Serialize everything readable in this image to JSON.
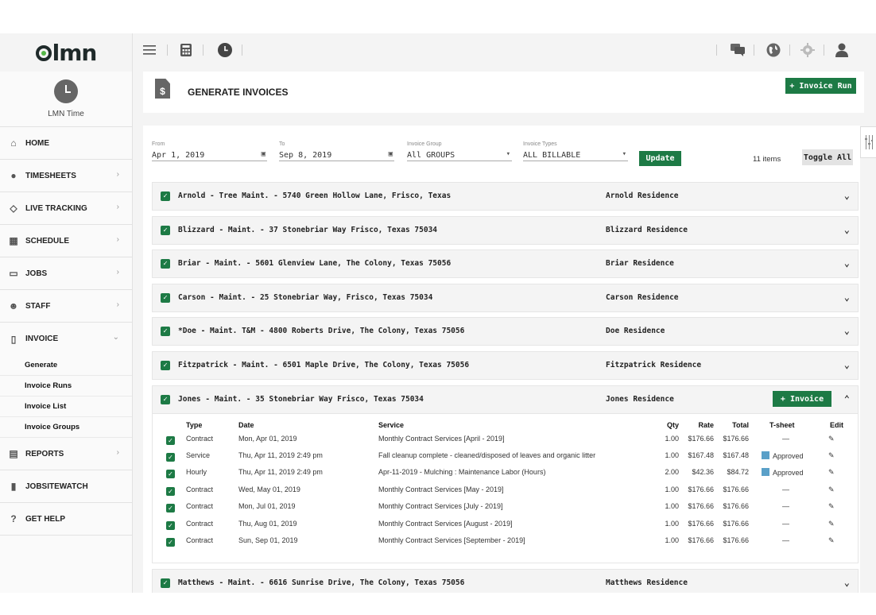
{
  "brand": {
    "logo_text": "lmn"
  },
  "sidebar": {
    "module_label": "LMN Time",
    "items": [
      {
        "label": "HOME",
        "icon": "home-icon",
        "chevron": ""
      },
      {
        "label": "TIMESHEETS",
        "icon": "timesheets-icon",
        "chevron": "›"
      },
      {
        "label": "LIVE TRACKING",
        "icon": "live-tracking-icon",
        "chevron": "›"
      },
      {
        "label": "SCHEDULE",
        "icon": "calendar-icon",
        "chevron": "›"
      },
      {
        "label": "JOBS",
        "icon": "briefcase-icon",
        "chevron": "›"
      },
      {
        "label": "STAFF",
        "icon": "staff-icon",
        "chevron": "›"
      },
      {
        "label": "INVOICE",
        "icon": "invoice-icon",
        "chevron": "⌄"
      }
    ],
    "invoice_sub": [
      "Generate",
      "Invoice Runs",
      "Invoice List",
      "Invoice Groups"
    ],
    "items_after": [
      {
        "label": "REPORTS",
        "icon": "reports-icon",
        "chevron": "›"
      },
      {
        "label": "JOBSITEWATCH",
        "icon": "jobsitewatch-icon",
        "chevron": ""
      },
      {
        "label": "GET HELP",
        "icon": "help-icon",
        "chevron": ""
      }
    ]
  },
  "header": {
    "title": "GENERATE INVOICES",
    "invoice_run_label": "+ Invoice Run",
    "doc_glyph": "$"
  },
  "filters": {
    "from_label": "From",
    "from_value": "Apr 1, 2019",
    "to_label": "To",
    "to_value": "Sep 8, 2019",
    "group_label": "Invoice Group",
    "group_value": "All GROUPS",
    "types_label": "Invoice Types",
    "types_value": "ALL BILLABLE",
    "update_label": "Update",
    "items_count": "11 items",
    "toggle_all_label": "Toggle All"
  },
  "jobs": [
    {
      "title": "Arnold - Tree Maint. - 5740 Green Hollow Lane, Frisco, Texas",
      "residence": "Arnold Residence",
      "expanded": false
    },
    {
      "title": "Blizzard - Maint. - 37 Stonebriar Way Frisco, Texas 75034",
      "residence": "Blizzard Residence",
      "expanded": false
    },
    {
      "title": "Briar - Maint. - 5601 Glenview Lane, The Colony, Texas 75056",
      "residence": "Briar Residence",
      "expanded": false
    },
    {
      "title": "Carson - Maint. - 25 Stonebriar Way, Frisco, Texas 75034",
      "residence": "Carson Residence",
      "expanded": false
    },
    {
      "title": "*Doe - Maint. T&M - 4800 Roberts Drive, The Colony, Texas 75056",
      "residence": "Doe Residence",
      "expanded": false
    },
    {
      "title": "Fitzpatrick - Maint. - 6501 Maple Drive, The Colony, Texas 75056",
      "residence": "Fitzpatrick Residence",
      "expanded": false
    },
    {
      "title": "Jones - Maint. - 35 Stonebriar Way Frisco, Texas 75034",
      "residence": "Jones Residence",
      "expanded": true,
      "invoice_label": "+ Invoice"
    },
    {
      "title": "Matthews - Maint. - 6616 Sunrise Drive, The Colony, Texas 75056",
      "residence": "Matthews Residence",
      "expanded": false
    }
  ],
  "jones_table": {
    "headers": {
      "type": "Type",
      "date": "Date",
      "service": "Service",
      "qty": "Qty",
      "rate": "Rate",
      "total": "Total",
      "tsheet": "T-sheet",
      "edit": "Edit"
    },
    "rows": [
      {
        "type": "Contract",
        "date": "Mon, Apr 01, 2019",
        "service": "Monthly Contract Services [April - 2019]",
        "qty": "1.00",
        "rate": "$176.66",
        "total": "$176.66",
        "tsheet": "—",
        "approved": false
      },
      {
        "type": "Service",
        "date": "Thu, Apr 11, 2019 2:49 pm",
        "service": "Fall cleanup complete - cleaned/disposed of leaves and organic litter",
        "qty": "1.00",
        "rate": "$167.48",
        "total": "$167.48",
        "tsheet": "Approved",
        "approved": true
      },
      {
        "type": "Hourly",
        "date": "Thu, Apr 11, 2019 2:49 pm",
        "service": "Apr-11-2019 - Mulching : Maintenance Labor (Hours)",
        "qty": "2.00",
        "rate": "$42.36",
        "total": "$84.72",
        "tsheet": "Approved",
        "approved": true
      },
      {
        "type": "Contract",
        "date": "Wed, May 01, 2019",
        "service": "Monthly Contract Services [May - 2019]",
        "qty": "1.00",
        "rate": "$176.66",
        "total": "$176.66",
        "tsheet": "—",
        "approved": false
      },
      {
        "type": "Contract",
        "date": "Mon, Jul 01, 2019",
        "service": "Monthly Contract Services [July - 2019]",
        "qty": "1.00",
        "rate": "$176.66",
        "total": "$176.66",
        "tsheet": "—",
        "approved": false
      },
      {
        "type": "Contract",
        "date": "Thu, Aug 01, 2019",
        "service": "Monthly Contract Services [August - 2019]",
        "qty": "1.00",
        "rate": "$176.66",
        "total": "$176.66",
        "tsheet": "—",
        "approved": false
      },
      {
        "type": "Contract",
        "date": "Sun, Sep 01, 2019",
        "service": "Monthly Contract Services [September - 2019]",
        "qty": "1.00",
        "rate": "$176.66",
        "total": "$176.66",
        "tsheet": "—",
        "approved": false
      }
    ]
  },
  "colors": {
    "accent": "#1d7a45",
    "approved": "#5aa0c8",
    "sidebar_bg": "#fafafa",
    "page_bg": "#f4f4f4"
  }
}
